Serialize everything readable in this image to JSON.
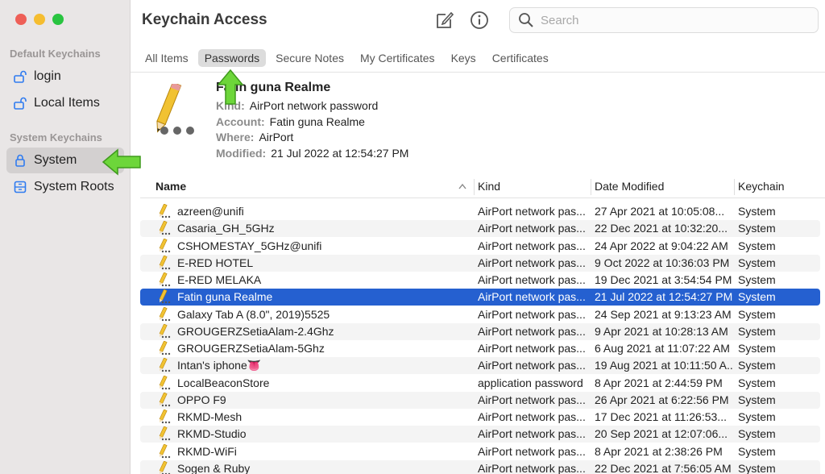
{
  "window": {
    "title": "Keychain Access"
  },
  "sidebar": {
    "default_header": "Default Keychains",
    "system_header": "System Keychains",
    "items": [
      {
        "label": "login"
      },
      {
        "label": "Local Items"
      },
      {
        "label": "System"
      },
      {
        "label": "System Roots"
      }
    ],
    "selected": "System"
  },
  "toolbar": {
    "new_item_icon": "compose-icon",
    "info_icon": "info-icon",
    "search_placeholder": "Search"
  },
  "tabs": [
    {
      "label": "All Items"
    },
    {
      "label": "Passwords"
    },
    {
      "label": "Secure Notes"
    },
    {
      "label": "My Certificates"
    },
    {
      "label": "Keys"
    },
    {
      "label": "Certificates"
    }
  ],
  "active_tab": "Passwords",
  "detail": {
    "name": "Fatin guna Realme",
    "kind_label": "Kind:",
    "kind": "AirPort network password",
    "account_label": "Account:",
    "account": "Fatin guna Realme",
    "where_label": "Where:",
    "where": "AirPort",
    "modified_label": "Modified:",
    "modified": "21 Jul 2022 at 12:54:27 PM"
  },
  "table": {
    "columns": [
      "Name",
      "Kind",
      "Date Modified",
      "Keychain"
    ],
    "rows": [
      {
        "name": "azreen@unifi",
        "kind": "AirPort network pas...",
        "date": "27 Apr 2021 at 10:05:08...",
        "keychain": "System"
      },
      {
        "name": "Casaria_GH_5GHz",
        "kind": "AirPort network pas...",
        "date": "22 Dec 2021 at 10:32:20...",
        "keychain": "System"
      },
      {
        "name": "CSHOMESTAY_5GHz@unifi",
        "kind": "AirPort network pas...",
        "date": "24 Apr 2022 at 9:04:22 AM",
        "keychain": "System"
      },
      {
        "name": "E-RED HOTEL",
        "kind": "AirPort network pas...",
        "date": "9 Oct 2022 at 10:36:03 PM",
        "keychain": "System"
      },
      {
        "name": "E-RED MELAKA",
        "kind": "AirPort network pas...",
        "date": "19 Dec 2021 at 3:54:54 PM",
        "keychain": "System"
      },
      {
        "name": "Fatin guna Realme",
        "kind": "AirPort network pas...",
        "date": "21 Jul 2022 at 12:54:27 PM",
        "keychain": "System"
      },
      {
        "name": "Galaxy Tab A (8.0\", 2019)5525",
        "kind": "AirPort network pas...",
        "date": "24 Sep 2021 at 9:13:23 AM",
        "keychain": "System"
      },
      {
        "name": "GROUGERZSetiaAlam-2.4Ghz",
        "kind": "AirPort network pas...",
        "date": "9 Apr 2021 at 10:28:13 AM",
        "keychain": "System"
      },
      {
        "name": "GROUGERZSetiaAlam-5Ghz",
        "kind": "AirPort network pas...",
        "date": "6 Aug 2021 at 11:07:22 AM",
        "keychain": "System"
      },
      {
        "name": "Intan's iphone👅",
        "kind": "AirPort network pas...",
        "date": "19 Aug 2021 at 10:11:50 A...",
        "keychain": "System"
      },
      {
        "name": "LocalBeaconStore",
        "kind": "application password",
        "date": "8 Apr 2021 at 2:44:59 PM",
        "keychain": "System"
      },
      {
        "name": "OPPO F9",
        "kind": "AirPort network pas...",
        "date": "26 Apr 2021 at 6:22:56 PM",
        "keychain": "System"
      },
      {
        "name": "RKMD-Mesh",
        "kind": "AirPort network pas...",
        "date": "17 Dec 2021 at 11:26:53...",
        "keychain": "System"
      },
      {
        "name": "RKMD-Studio",
        "kind": "AirPort network pas...",
        "date": "20 Sep 2021 at 12:07:06...",
        "keychain": "System"
      },
      {
        "name": "RKMD-WiFi",
        "kind": "AirPort network pas...",
        "date": "8 Apr 2021 at 2:38:26 PM",
        "keychain": "System"
      },
      {
        "name": "Sogen & Ruby",
        "kind": "AirPort network pas...",
        "date": "22 Dec 2021 at 7:56:05 AM",
        "keychain": "System"
      }
    ],
    "selected_row": "Fatin guna Realme"
  },
  "colors": {
    "selection": "#2560d0",
    "sidebar_bg": "#e9e6e6",
    "annotation_arrow": "#6dd63a"
  }
}
